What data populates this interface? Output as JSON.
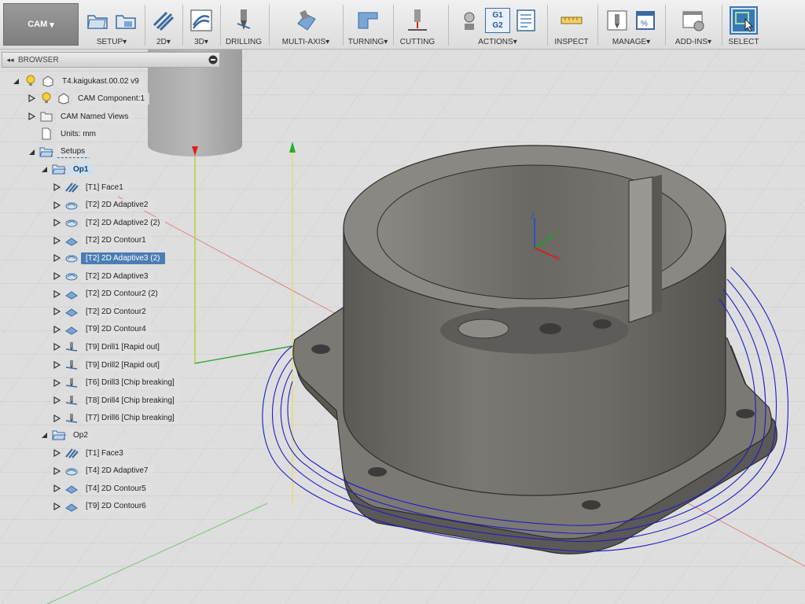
{
  "workspace": {
    "label": "CAM"
  },
  "toolbar": {
    "groups": [
      {
        "id": "setup",
        "label": "SETUP"
      },
      {
        "id": "2d",
        "label": "2D"
      },
      {
        "id": "3d",
        "label": "3D"
      },
      {
        "id": "drilling",
        "label": "DRILLING"
      },
      {
        "id": "multiaxis",
        "label": "MULTI-AXIS"
      },
      {
        "id": "turning",
        "label": "TURNING"
      },
      {
        "id": "cutting",
        "label": "CUTTING"
      },
      {
        "id": "actions",
        "label": "ACTIONS"
      },
      {
        "id": "inspect",
        "label": "INSPECT"
      },
      {
        "id": "manage",
        "label": "MANAGE"
      },
      {
        "id": "addins",
        "label": "ADD-INS"
      },
      {
        "id": "select",
        "label": "SELECT"
      }
    ],
    "dropdown_mark": "▾",
    "g1g2": {
      "top": "G1",
      "bottom": "G2"
    }
  },
  "browser": {
    "title": "BROWSER",
    "collapse_glyph": "◂◂",
    "root": "T4.kaigukast.00.02 v9",
    "component": "CAM Component:1",
    "named_views": "CAM Named Views",
    "units": "Units: mm",
    "setups": "Setups",
    "op1": {
      "label": "Op1",
      "ops": [
        {
          "label": "[T1] Face1",
          "icon": "face-op-icon"
        },
        {
          "label": "[T2] 2D Adaptive2",
          "icon": "adaptive-op-icon"
        },
        {
          "label": "[T2] 2D Adaptive2 (2)",
          "icon": "adaptive-op-icon"
        },
        {
          "label": "[T2] 2D Contour1",
          "icon": "contour-op-icon"
        },
        {
          "label": "[T2] 2D Adaptive3 (2)",
          "icon": "adaptive-op-icon",
          "selected": true
        },
        {
          "label": "[T2] 2D Adaptive3",
          "icon": "adaptive-op-icon"
        },
        {
          "label": "[T2] 2D Contour2 (2)",
          "icon": "contour-op-icon"
        },
        {
          "label": "[T2] 2D Contour2",
          "icon": "contour-op-icon"
        },
        {
          "label": "[T9] 2D Contour4",
          "icon": "contour-op-icon"
        },
        {
          "label": "[T9] Drill1 [Rapid out]",
          "icon": "drill-op-icon"
        },
        {
          "label": "[T9] Drill2 [Rapid out]",
          "icon": "drill-op-icon"
        },
        {
          "label": "[T6] Drill3 [Chip breaking]",
          "icon": "drill-op-icon"
        },
        {
          "label": "[T8] Drill4 [Chip breaking]",
          "icon": "drill-op-icon"
        },
        {
          "label": "[T7] Drill6 [Chip breaking]",
          "icon": "drill-op-icon"
        }
      ]
    },
    "op2": {
      "label": "Op2",
      "ops": [
        {
          "label": "[T1] Face3",
          "icon": "face-op-icon"
        },
        {
          "label": "[T4] 2D Adaptive7",
          "icon": "adaptive-op-icon"
        },
        {
          "label": "[T4] 2D Contour5",
          "icon": "contour-op-icon"
        },
        {
          "label": "[T9] 2D Contour6",
          "icon": "contour-op-icon"
        }
      ]
    }
  },
  "triad": {
    "x": "X",
    "y": "Y",
    "z": "Z"
  },
  "colors": {
    "accent": "#3a78b5",
    "selected": "#4a7db3",
    "toolpath": "#1c1cc8",
    "part": "#6e6c67",
    "axis_x": "#e03030",
    "axis_y": "#20c020",
    "axis_z": "#e8e030"
  }
}
